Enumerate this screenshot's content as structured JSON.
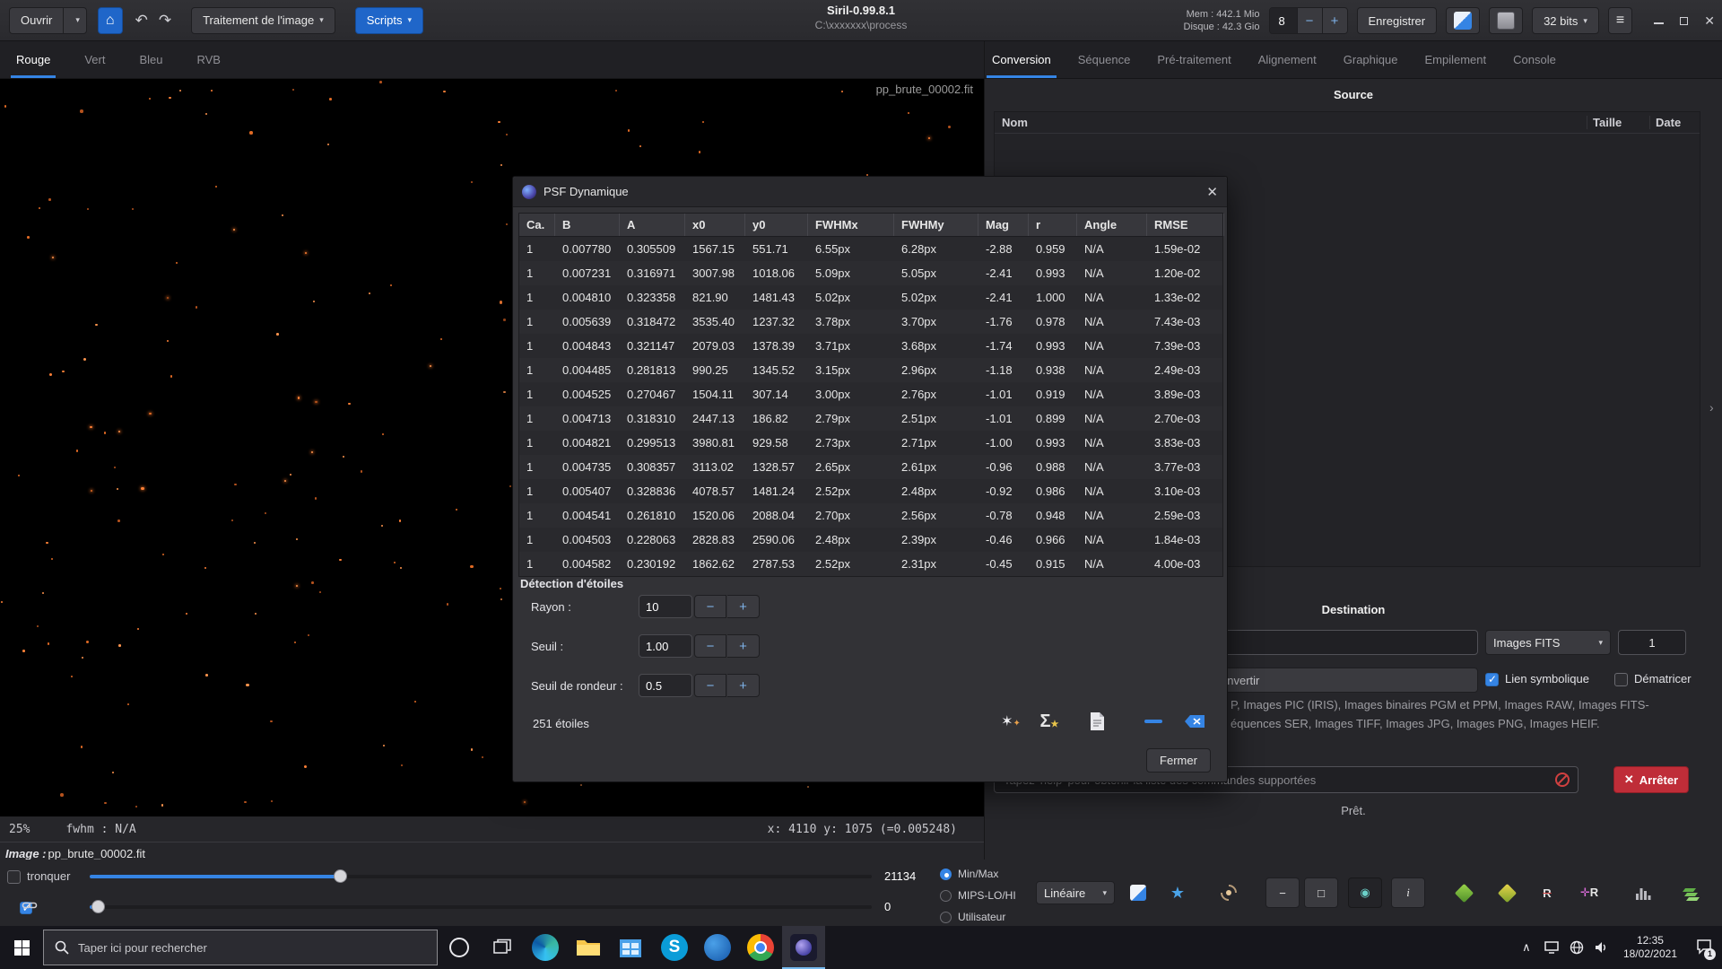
{
  "toolbar": {
    "open": "Ouvrir",
    "image_processing": "Traitement de l'image",
    "scripts": "Scripts",
    "title": "Siril-0.99.8.1",
    "subtitle": "C:\\xxxxxxx\\process",
    "mem": "Mem : 442.1 Mio",
    "disk": "Disque : 42.3 Gio",
    "spin_value": "8",
    "save": "Enregistrer",
    "bits": "32 bits"
  },
  "left_tabs": {
    "items": [
      "Rouge",
      "Vert",
      "Bleu",
      "RVB"
    ],
    "active": "Rouge"
  },
  "image": {
    "overlay_filename": "pp_brute_00002.fit"
  },
  "statusbar": {
    "zoom": "25%",
    "fwhm": "fwhm : N/A",
    "coords": "x: 4110 y: 1075 (=0.005248)"
  },
  "image_info": {
    "label": "Image :",
    "filename": "pp_brute_00002.fit"
  },
  "levels": {
    "tronquer": "tronquer",
    "hi": "21134",
    "lo": "0",
    "radios": [
      "Min/Max",
      "MIPS-LO/HI",
      "Utilisateur"
    ],
    "active_radio": "Min/Max",
    "scale": "Linéaire"
  },
  "dialog": {
    "title": "PSF Dynamique",
    "columns": [
      "Ca.",
      "B",
      "A",
      "x0",
      "y0",
      "FWHMx",
      "FWHMy",
      "Mag",
      "r",
      "Angle",
      "RMSE"
    ],
    "rows": [
      [
        "1",
        "0.007780",
        "0.305509",
        "1567.15",
        "551.71",
        "6.55px",
        "6.28px",
        "-2.88",
        "0.959",
        "N/A",
        "1.59e-02"
      ],
      [
        "1",
        "0.007231",
        "0.316971",
        "3007.98",
        "1018.06",
        "5.09px",
        "5.05px",
        "-2.41",
        "0.993",
        "N/A",
        "1.20e-02"
      ],
      [
        "1",
        "0.004810",
        "0.323358",
        "821.90",
        "1481.43",
        "5.02px",
        "5.02px",
        "-2.41",
        "1.000",
        "N/A",
        "1.33e-02"
      ],
      [
        "1",
        "0.005639",
        "0.318472",
        "3535.40",
        "1237.32",
        "3.78px",
        "3.70px",
        "-1.76",
        "0.978",
        "N/A",
        "7.43e-03"
      ],
      [
        "1",
        "0.004843",
        "0.321147",
        "2079.03",
        "1378.39",
        "3.71px",
        "3.68px",
        "-1.74",
        "0.993",
        "N/A",
        "7.39e-03"
      ],
      [
        "1",
        "0.004485",
        "0.281813",
        "990.25",
        "1345.52",
        "3.15px",
        "2.96px",
        "-1.18",
        "0.938",
        "N/A",
        "2.49e-03"
      ],
      [
        "1",
        "0.004525",
        "0.270467",
        "1504.11",
        "307.14",
        "3.00px",
        "2.76px",
        "-1.01",
        "0.919",
        "N/A",
        "3.89e-03"
      ],
      [
        "1",
        "0.004713",
        "0.318310",
        "2447.13",
        "186.82",
        "2.79px",
        "2.51px",
        "-1.01",
        "0.899",
        "N/A",
        "2.70e-03"
      ],
      [
        "1",
        "0.004821",
        "0.299513",
        "3980.81",
        "929.58",
        "2.73px",
        "2.71px",
        "-1.00",
        "0.993",
        "N/A",
        "3.83e-03"
      ],
      [
        "1",
        "0.004735",
        "0.308357",
        "3113.02",
        "1328.57",
        "2.65px",
        "2.61px",
        "-0.96",
        "0.988",
        "N/A",
        "3.77e-03"
      ],
      [
        "1",
        "0.005407",
        "0.328836",
        "4078.57",
        "1481.24",
        "2.52px",
        "2.48px",
        "-0.92",
        "0.986",
        "N/A",
        "3.10e-03"
      ],
      [
        "1",
        "0.004541",
        "0.261810",
        "1520.06",
        "2088.04",
        "2.70px",
        "2.56px",
        "-0.78",
        "0.948",
        "N/A",
        "2.59e-03"
      ],
      [
        "1",
        "0.004503",
        "0.228063",
        "2828.83",
        "2590.06",
        "2.48px",
        "2.39px",
        "-0.46",
        "0.966",
        "N/A",
        "1.84e-03"
      ],
      [
        "1",
        "0.004582",
        "0.230192",
        "1862.62",
        "2787.53",
        "2.52px",
        "2.31px",
        "-0.45",
        "0.915",
        "N/A",
        "4.00e-03"
      ]
    ],
    "section": "Détection d'étoiles",
    "rayon_label": "Rayon :",
    "rayon": "10",
    "seuil_label": "Seuil :",
    "seuil": "1.00",
    "rondeur_label": "Seuil de rondeur :",
    "rondeur": "0.5",
    "count": "251 étoiles",
    "close": "Fermer"
  },
  "right_panel": {
    "tabs": [
      "Conversion",
      "Séquence",
      "Pré-traitement",
      "Alignement",
      "Graphique",
      "Empilement",
      "Console"
    ],
    "active_tab": "Conversion",
    "source": "Source",
    "list_columns": [
      "Nom",
      "Taille",
      "Date"
    ],
    "destination": "Destination",
    "filetype": "Images FITS",
    "count": "1",
    "convert": "Convertir",
    "symlink": "Lien symbolique",
    "demosaic": "Dématricer",
    "formats_line1": "P, Images PIC (IRIS), Images binaires PGM et PPM, Images RAW, Images FITS-",
    "formats_line2": "équences SER, Images TIFF, Images JPG, Images PNG, Images HEIF.",
    "command_placeholder": "Tapez 'help' pour obtenir la liste des commandes supportées",
    "stop": "Arrêter",
    "ready": "Prêt."
  },
  "taskbar": {
    "search_placeholder": "Taper ici pour rechercher",
    "time": "12:35",
    "date": "18/02/2021",
    "badge": "1",
    "app_icons": [
      "edge-icon",
      "explorer-icon",
      "store-icon",
      "skype-icon",
      "onedrive-icon",
      "chrome-icon",
      "siril-icon"
    ]
  },
  "colors": {
    "accent": "#3584e4",
    "star": "#ff8036",
    "danger": "#bf2d38"
  }
}
